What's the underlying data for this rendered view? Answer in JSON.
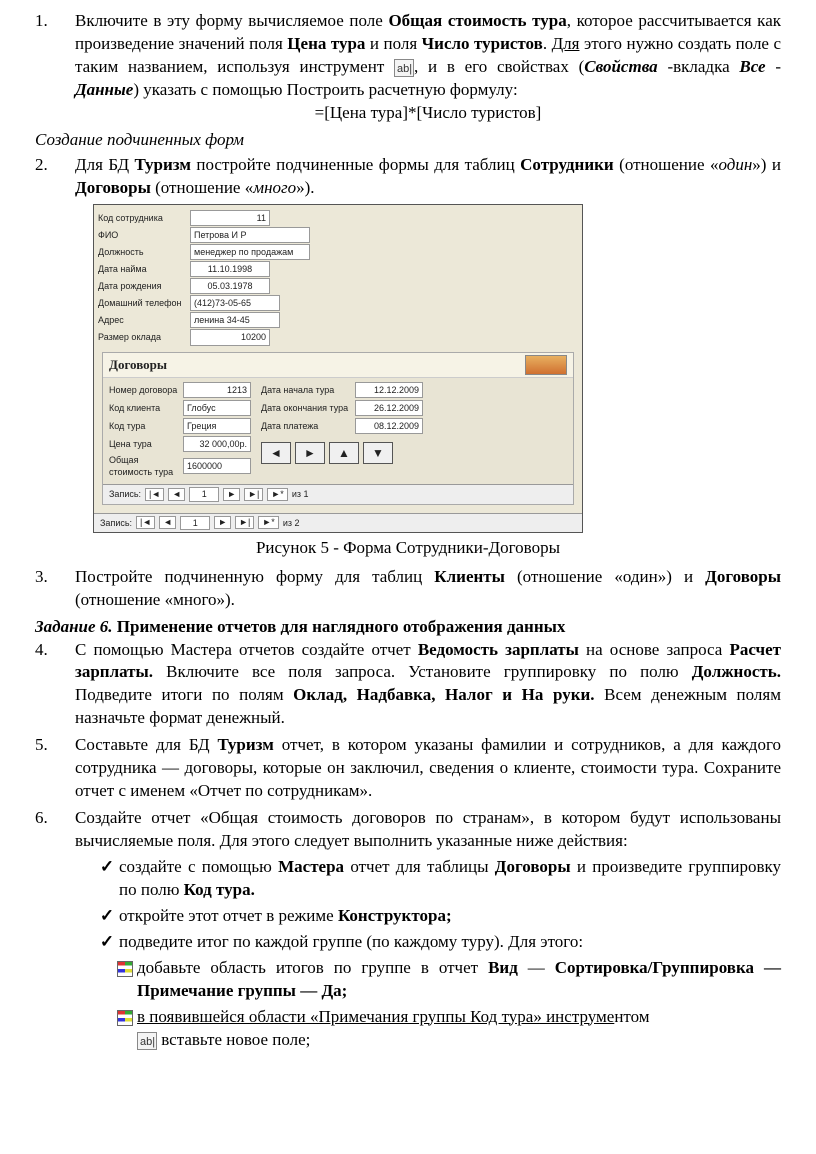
{
  "item1": {
    "num": "1.",
    "t1": "Включите в эту форму вычисляемое поле ",
    "t2": "Общая стоимость тура",
    "t3": ", которое рассчитывается как произведение значений поля ",
    "t4": "Цена тура",
    "t5": " и поля ",
    "t6": "Число туристов",
    "t7": ". ",
    "t8": "Для",
    "t9": " этого нужно создать поле с таким названием, используя инструмент ",
    "t10": ", и в его свойствах (",
    "t11": "Свойства ",
    "t12": "-вкладка ",
    "t13": "Все",
    "t14": " - ",
    "t15": "Данные",
    "t16": ") указать с помощью Построить расчетную формулу:",
    "formula": "=[Цена тура]*[Число туристов]"
  },
  "section1": "Создание подчиненных форм",
  "item2": {
    "num": "2.",
    "t1": "Для БД ",
    "t2": "Туризм",
    "t3": " постройте подчиненные формы для таблиц ",
    "t4": "Сотрудники",
    "t5": " (отношение «",
    "t6": "один",
    "t7": "») и ",
    "t8": "Договоры",
    "t9": " (отношение «",
    "t10": "много",
    "t11": "»)."
  },
  "form": {
    "labels": {
      "kod": "Код сотрудника",
      "fio": "ФИО",
      "dolzh": "Должность",
      "hire": "Дата найма",
      "birth": "Дата рождения",
      "phone": "Домашний телефон",
      "addr": "Адрес",
      "oklad": "Размер оклада"
    },
    "vals": {
      "kod": "11",
      "fio": "Петрова И Р",
      "dolzh": "менеджер по продажам",
      "hire": "11.10.1998",
      "birth": "05.03.1978",
      "phone": "(412)73-05-65",
      "addr": "ленина 34-45",
      "oklad": "10200"
    },
    "sub": {
      "title": "Договоры",
      "labels": {
        "ndog": "Номер договора",
        "kkl": "Код клиента",
        "ktur": "Код тура",
        "ctur": "Цена тура",
        "tot": "Общая стоимость тура",
        "dstart": "Дата начала тура",
        "dend": "Дата окончания тура",
        "dpay": "Дата платежа"
      },
      "vals": {
        "ndog": "1213",
        "kkl": "Глобус",
        "ktur": "Греция",
        "ctur": "32 000,00р.",
        "tot": "1600000",
        "dstart": "12.12.2009",
        "dend": "26.12.2009",
        "dpay": "08.12.2009"
      }
    },
    "rec1": {
      "label": "Запись:",
      "val": "1",
      "of": "из  1"
    },
    "rec2": {
      "label": "Запись:",
      "val": "1",
      "of": "из  2"
    }
  },
  "caption": "Рисунок 5 - Форма Сотрудники-Договоры",
  "item3": {
    "num": "3.",
    "t1": "Постройте подчиненную форму для таблиц ",
    "t2": "Клиенты",
    "t3": " (отношение «один») и ",
    "t4": "Договоры",
    "t5": " (отношение «много»)."
  },
  "task6": {
    "lead": "Задание 6.",
    "rest": " Применение отчетов для наглядного отображения данных"
  },
  "item4": {
    "num": "4.",
    "t1": "С помощью Мастера отчетов создайте отчет ",
    "t2": "Ведомость зарплаты",
    "t3": " на основе запроса ",
    "t4": "Расчет зарплаты.",
    "t5": " Включите все поля запроса. Установите группировку по полю ",
    "t6": "Должность.",
    "t7": " Подведите итоги по полям ",
    "t8": "Оклад, Надбавка, Налог и На руки.",
    "t9": " Всем денежным полям назначьте формат денежный."
  },
  "item5": {
    "num": "5.",
    "t1": "Составьте для БД ",
    "t2": "Туризм",
    "t3": " отчет, в котором указаны фамилии и сотрудников, а для каждого сотрудника — договоры, которые он заключил, сведения о клиенте, стоимости тура. Сохраните отчет с именем «Отчет по сотрудникам»."
  },
  "item6": {
    "num": "6.",
    "t1": "Создайте отчет «Общая стоимость договоров по странам», в котором будут использованы вычисляемые поля. Для этого следует выполнить указанные ниже действия:"
  },
  "sub1": {
    "t1": "создайте с помощью ",
    "t2": "Мастера",
    "t3": " отчет для таблицы ",
    "t4": "Договоры",
    "t5": " и произведите группировку по полю ",
    "t6": "Код тура."
  },
  "sub2": {
    "t1": "откройте этот отчет в режиме ",
    "t2": "Конструктора;"
  },
  "sub3": {
    "t1": "подведите итог по каждой группе (по каждому туру). Для этого:"
  },
  "sub4": {
    "t1": "добавьте область итогов по группе в отчет ",
    "t2": "Вид",
    "t3": " — ",
    "t4": "Сортировка/Группировка — Примечание группы — Да;"
  },
  "sub5": {
    "t1": "в появившейся области «Примечания группы Код тура» инструме",
    "t1b": "нтом",
    "t2": " вставьте новое поле;"
  }
}
